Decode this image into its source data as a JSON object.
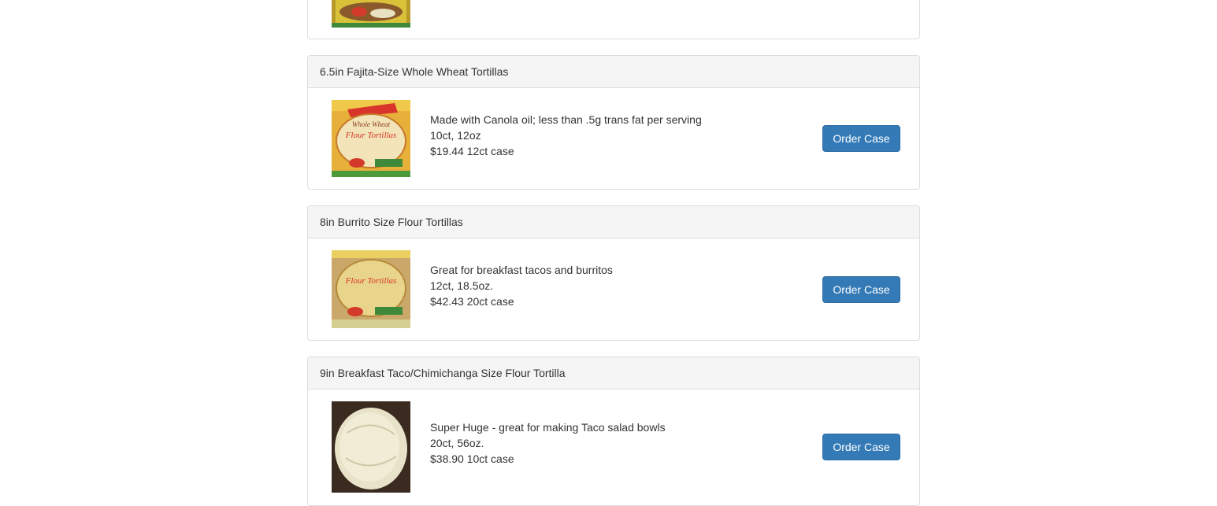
{
  "products": [
    {
      "title": "",
      "lines": [
        "",
        "",
        ""
      ],
      "order_label": ""
    },
    {
      "title": "6.5in Fajita-Size Whole Wheat Tortillas",
      "lines": [
        "Made with Canola oil; less than .5g trans fat per serving",
        "10ct, 12oz",
        "$19.44 12ct case"
      ],
      "order_label": "Order Case",
      "image_icon": "whole-wheat-flour-tortilla-package-image",
      "image_text": [
        "Whole Wheat",
        "Flour Tortillas"
      ]
    },
    {
      "title": "8in Burrito Size Flour Tortillas",
      "lines": [
        "Great for breakfast tacos and burritos",
        "12ct, 18.5oz.",
        "$42.43 20ct case"
      ],
      "order_label": "Order Case",
      "image_icon": "flour-tortilla-package-image",
      "image_text": [
        "Flour Tortillas"
      ]
    },
    {
      "title": "9in Breakfast Taco/Chimichanga Size Flour Tortilla",
      "lines": [
        "Super Huge - great for making Taco salad bowls",
        "20ct, 56oz.",
        "$38.90 10ct case"
      ],
      "order_label": "Order Case",
      "image_icon": "plain-tortilla-bag-image"
    }
  ],
  "colors": {
    "button_bg": "#337ab7",
    "panel_heading_bg": "#f5f5f5",
    "panel_border": "#dddddd"
  }
}
